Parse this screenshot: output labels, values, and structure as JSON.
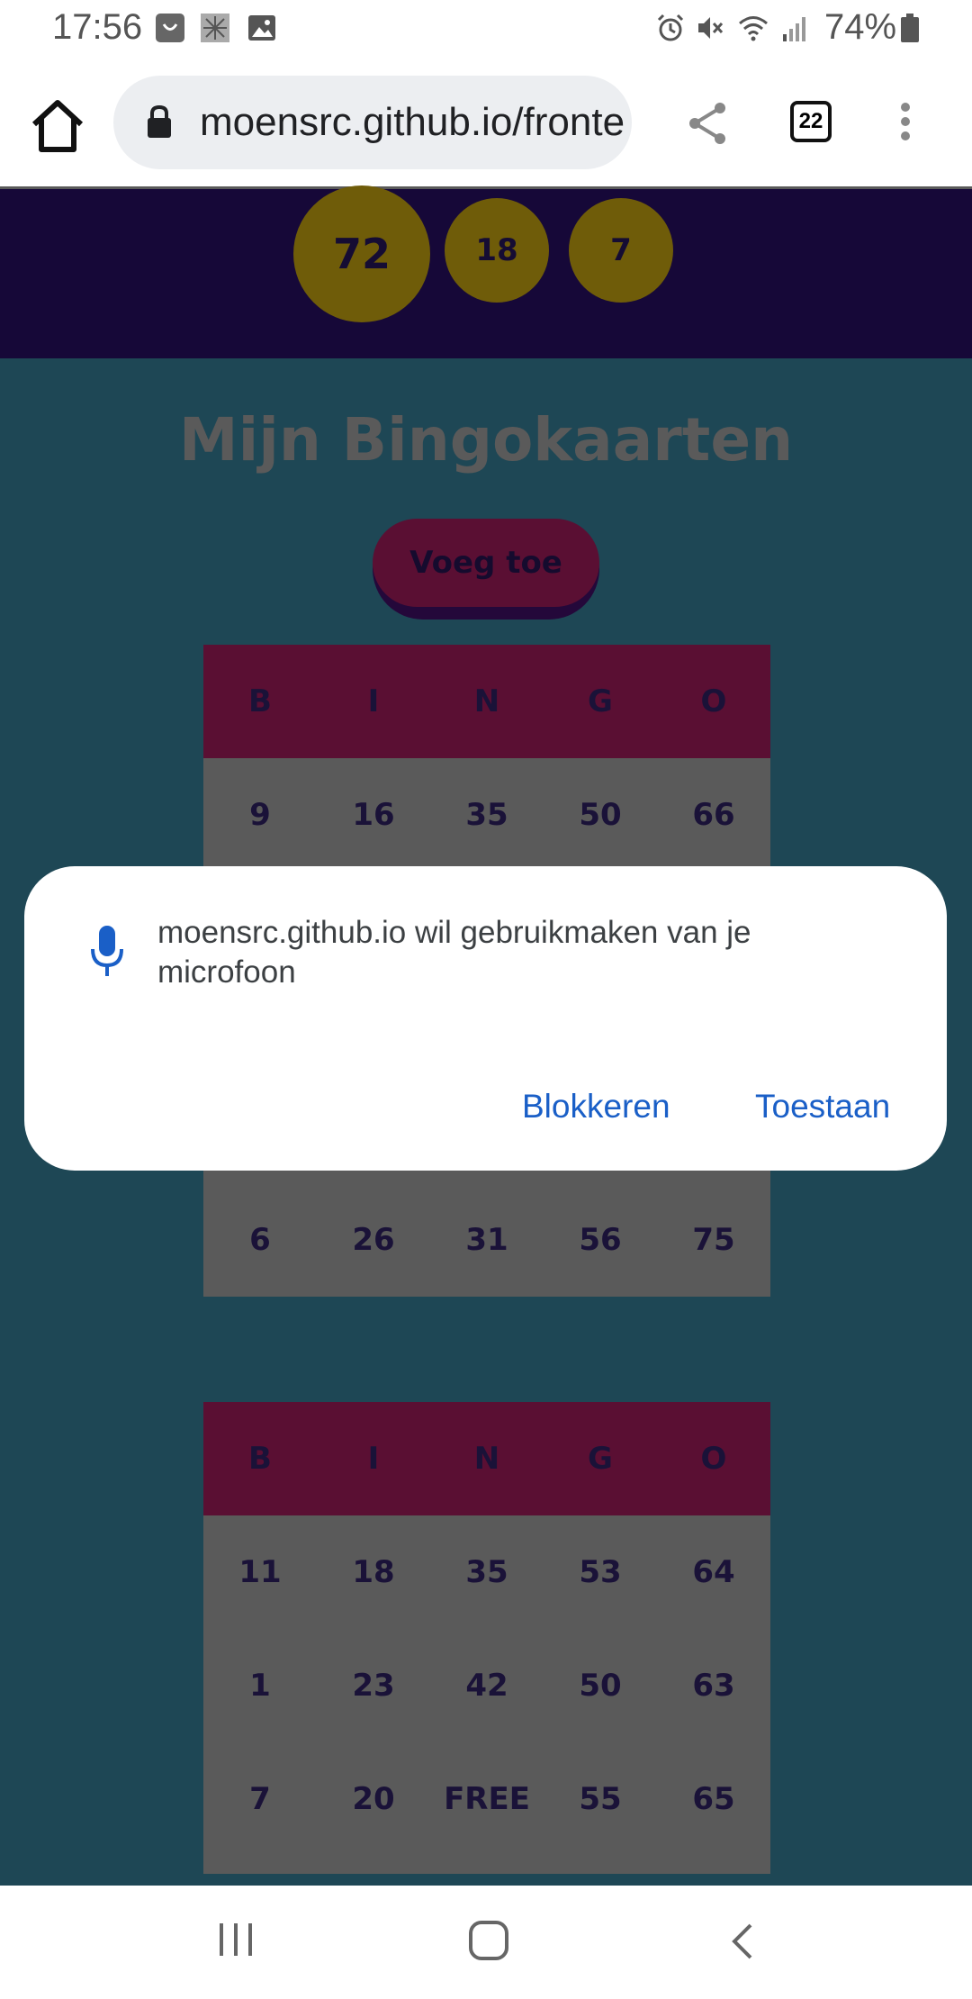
{
  "status_bar": {
    "time": "17:56",
    "battery_percent": "74%",
    "left_icons": [
      "bag-notification-icon",
      "photo-notification-icon",
      "gallery-notification-icon"
    ],
    "right_icons": [
      "alarm-icon",
      "mute-icon",
      "wifi-icon",
      "signal-icon",
      "battery-icon"
    ]
  },
  "browser": {
    "url": "moensrc.github.io/fronte",
    "tab_count": "22"
  },
  "called_balls": [
    "72",
    "18",
    "7"
  ],
  "page": {
    "title": "Mijn Bingokaarten",
    "add_button": "Voeg toe"
  },
  "cards": [
    {
      "headers": [
        "B",
        "I",
        "N",
        "G",
        "O"
      ],
      "rows": [
        [
          "9",
          "16",
          "35",
          "50",
          "66"
        ],
        [
          "6",
          "26",
          "31",
          "56",
          "75"
        ]
      ]
    },
    {
      "headers": [
        "B",
        "I",
        "N",
        "G",
        "O"
      ],
      "rows": [
        [
          "11",
          "18",
          "35",
          "53",
          "64"
        ],
        [
          "1",
          "23",
          "42",
          "50",
          "63"
        ],
        [
          "7",
          "20",
          "FREE",
          "55",
          "65"
        ]
      ]
    }
  ],
  "permission_dialog": {
    "message": "moensrc.github.io wil gebruikmaken van je microfoon",
    "block_label": "Blokkeren",
    "allow_label": "Toestaan"
  },
  "colors": {
    "page_background": "#1e4755",
    "header_background": "#160838",
    "ball": "#6f5c09",
    "card_header": "#5a0f33",
    "card_cell": "#5a5a5a",
    "dialog_button": "#1a5fc7"
  }
}
